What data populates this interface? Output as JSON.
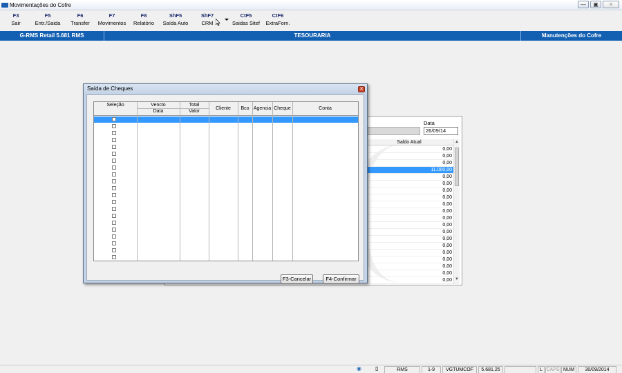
{
  "window": {
    "title": "Movimentações do Cofre",
    "controls": [
      "—",
      "▣",
      "✕"
    ]
  },
  "toolbar": [
    {
      "key": "F3",
      "label": "Sair"
    },
    {
      "key": "F5",
      "label": "Entr./Saida"
    },
    {
      "key": "F6",
      "label": "Transfer"
    },
    {
      "key": "F7",
      "label": "Movimentos"
    },
    {
      "key": "F8",
      "label": "Relatório"
    },
    {
      "key": "ShF5",
      "label": "Saída Auto"
    },
    {
      "key": "ShF7",
      "label": "CRM"
    },
    {
      "key": "CtF5",
      "label": "Saidas Sitef"
    },
    {
      "key": "CtF6",
      "label": "ExtraForn."
    }
  ],
  "header": {
    "left": "G-RMS Retail 5.681 RMS",
    "center": "TESOURARIA",
    "right": "Manutenções do Cofre"
  },
  "background": {
    "data_label": "Data",
    "data_value": "26/09/14",
    "saldo_header": "Saldo Atual",
    "saldo_rows": [
      "0,00",
      "0,00",
      "0,00",
      "11.000,00",
      "0,00",
      "0,00",
      "0,00",
      "0,00",
      "0,00",
      "0,00",
      "0,00",
      "0,00",
      "0,00",
      "0,00",
      "0,00",
      "0,00",
      "0,00",
      "0,00",
      "0,00",
      "0,00"
    ],
    "selected_index": 3
  },
  "dialog": {
    "title": "Saída de Cheques",
    "headers_top": {
      "selecao": "Seleção",
      "vencto": "Vencto",
      "total": "Total"
    },
    "headers_bottom": {
      "data": "Data",
      "valor": "Valor",
      "cliente": "Cliente",
      "bco": "Bco",
      "agencia": "Agencia",
      "cheque": "Cheque",
      "conta": "Conta"
    },
    "cancel_label": "F3-Cancelar",
    "confirm_label": "F4-Confirmar"
  },
  "statusbar": {
    "items": [
      "RMS",
      "1-9",
      "VGTUMCOF",
      "5.681.25",
      "",
      "L",
      "CAPS",
      "NUM",
      "30/09/2014"
    ]
  }
}
